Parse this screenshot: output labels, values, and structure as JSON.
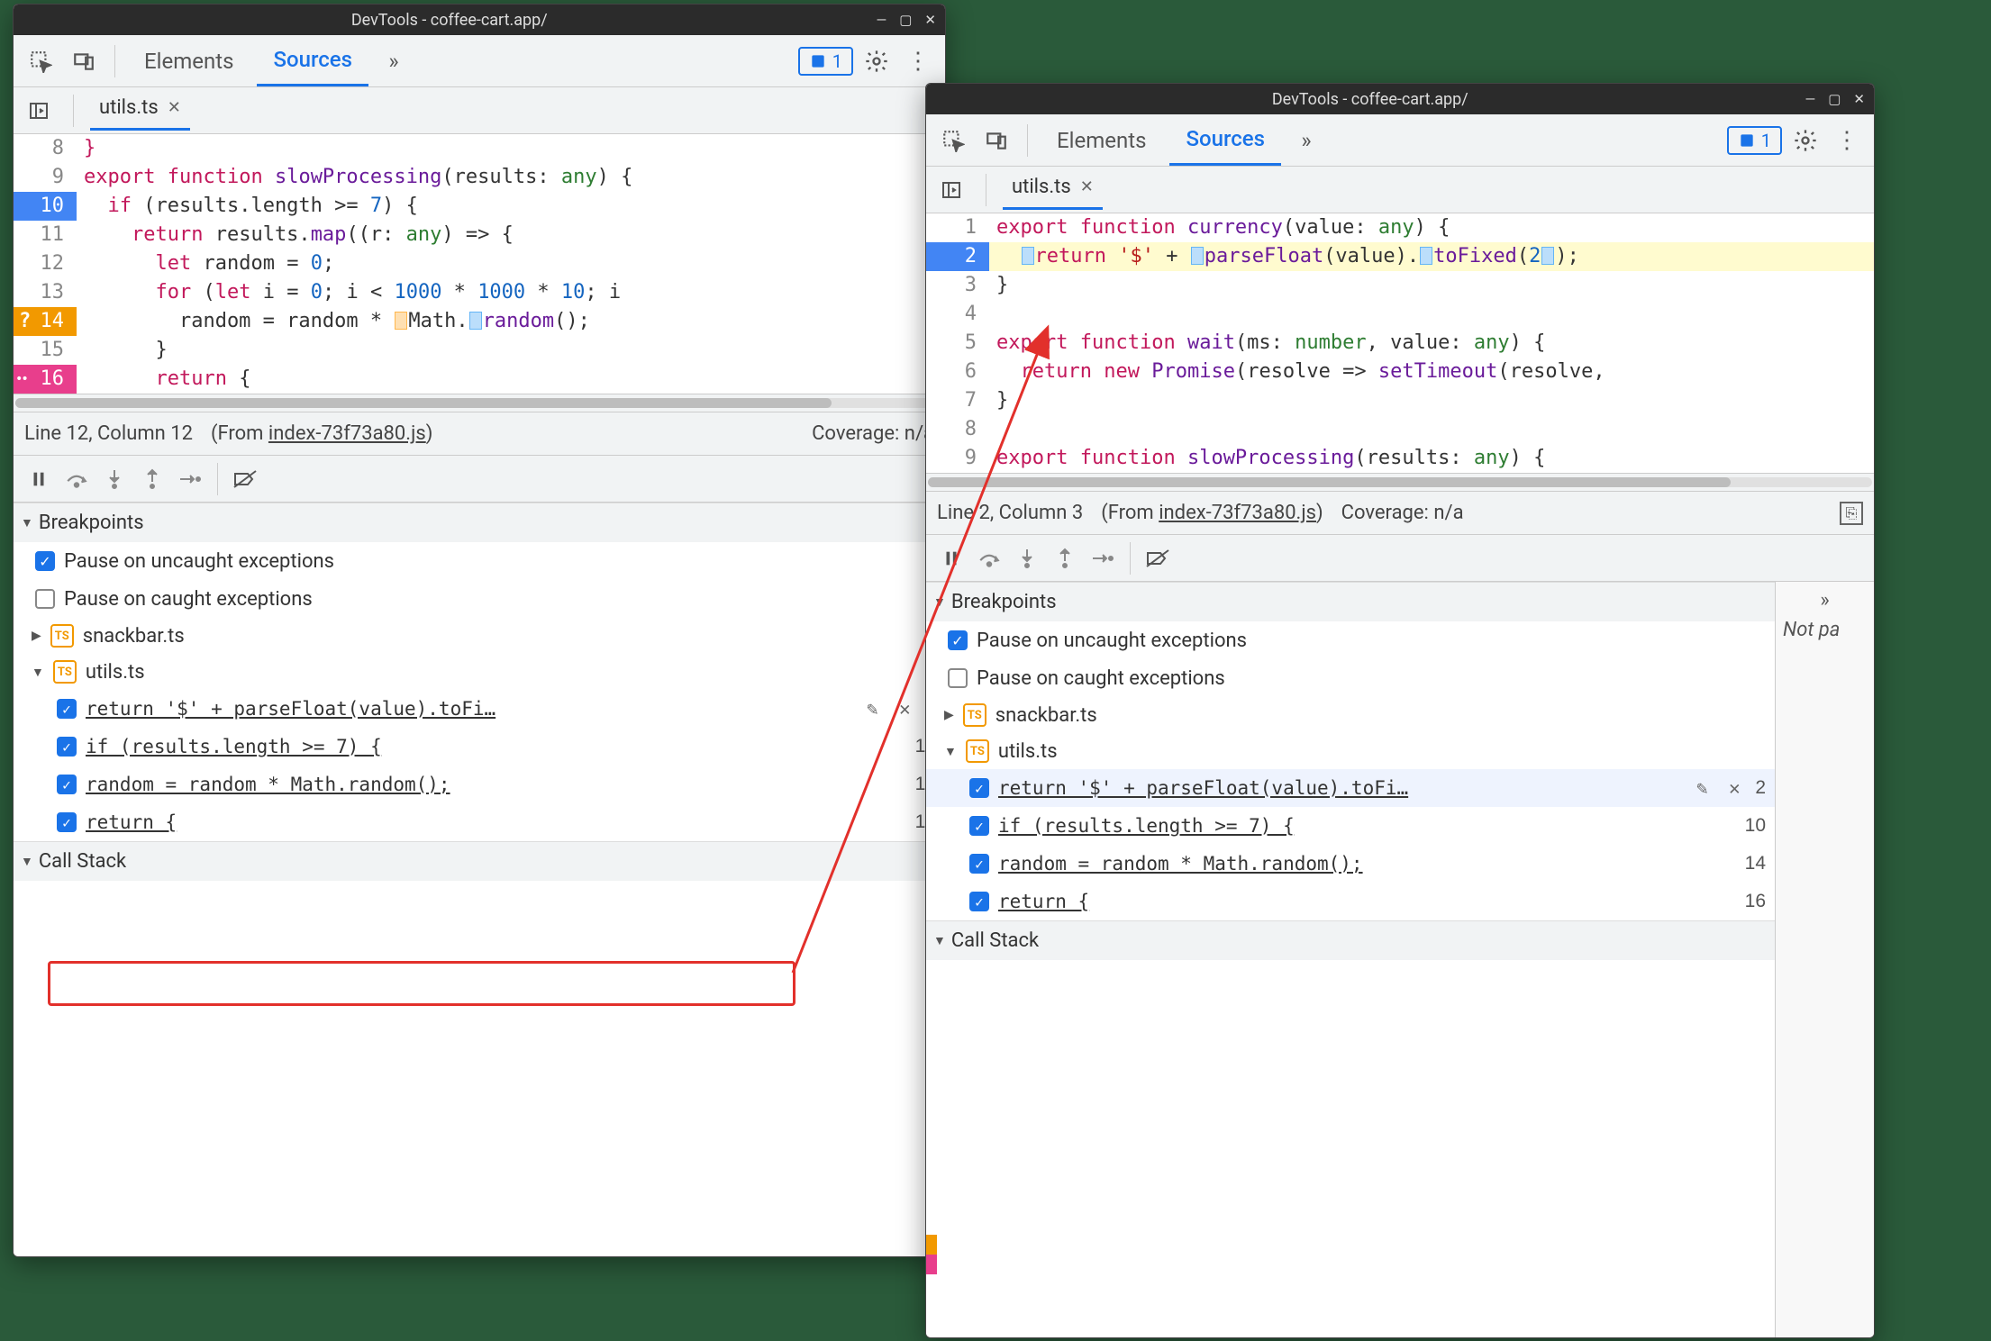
{
  "window_title": "DevTools - coffee-cart.app/",
  "toolbar_tabs": {
    "elements": "Elements",
    "sources": "Sources"
  },
  "issue_count": "1",
  "file_tab": "utils.ts",
  "left": {
    "status": {
      "line_col": "Line 12, Column 12",
      "from_prefix": "(From ",
      "from_link": "index-73f73a80.js",
      "from_suffix": ")",
      "coverage": "Coverage: n/a"
    },
    "code": [
      {
        "n": "8",
        "html": "<span class='kw'>}</span>"
      },
      {
        "n": "9",
        "html": "<span class='kw'>export</span> <span class='kw'>function</span> <span class='fn'>slowProcessing</span>(results: <span class='typ'>any</span>) {"
      },
      {
        "n": "10",
        "bp": "blue",
        "html": "  <span class='kw'>if</span> (results.length &gt;= <span class='num-lit'>7</span>) {"
      },
      {
        "n": "11",
        "html": "    <span class='kw'>return</span> results.<span class='fn'>map</span>((r: <span class='typ'>any</span>) =&gt; {"
      },
      {
        "n": "12",
        "html": "      <span class='kw'>let</span> random = <span class='num-lit'>0</span>;"
      },
      {
        "n": "13",
        "html": "      <span class='kw'>for</span> (<span class='kw'>let</span> i = <span class='num-lit'>0</span>; i &lt; <span class='num-lit'>1000</span> * <span class='num-lit'>1000</span> * <span class='num-lit'>10</span>; i"
      },
      {
        "n": "14",
        "bp": "orange",
        "bpq": true,
        "html": "        random = random * <span class='blk-marker blk-orange'></span>Math.<span class='blk-marker blk-blue'></span><span class='fn'>random</span>();"
      },
      {
        "n": "15",
        "html": "      }"
      },
      {
        "n": "16",
        "bp": "magenta",
        "bpd": true,
        "html": "      <span class='kw'>return</span> {"
      }
    ]
  },
  "right": {
    "status": {
      "line_col": "Line 2, Column 3",
      "from_prefix": "(From ",
      "from_link": "index-73f73a80.js",
      "from_suffix": ")",
      "coverage": "Coverage: n/a"
    },
    "notpaused": "Not pa",
    "code": [
      {
        "n": "1",
        "html": "<span class='kw'>export</span> <span class='kw'>function</span> <span class='fn'>currency</span>(value: <span class='typ'>any</span>) {"
      },
      {
        "n": "2",
        "bp": "blue",
        "hl": true,
        "html": "  <span class='blk-marker blk-blue'></span><span class='kw'>return</span> <span class='str'>'$'</span> + <span class='blk-marker blk-blue'></span><span class='fn'>parseFloat</span>(value).<span class='blk-marker blk-blue'></span><span class='fn'>toFixed</span>(<span class='num-lit'>2</span><span class='blk-marker blk-blue'></span>);"
      },
      {
        "n": "3",
        "html": "}"
      },
      {
        "n": "4",
        "html": ""
      },
      {
        "n": "5",
        "html": "<span class='kw'>export</span> <span class='kw'>function</span> <span class='fn'>wait</span>(ms: <span class='typ'>number</span>, value: <span class='typ'>any</span>) {"
      },
      {
        "n": "6",
        "html": "  <span class='kw'>return</span> <span class='kw'>new</span> <span class='fn'>Promise</span>(resolve =&gt; <span class='fn'>setTimeout</span>(resolve,"
      },
      {
        "n": "7",
        "html": "}"
      },
      {
        "n": "8",
        "html": ""
      },
      {
        "n": "9",
        "html": "<span class='kw'>export</span> <span class='kw'>function</span> <span class='fn'>slowProcessing</span>(results: <span class='typ'>any</span>) {"
      }
    ]
  },
  "sections": {
    "breakpoints": "Breakpoints",
    "callstack": "Call Stack",
    "pause_uncaught": "Pause on uncaught exceptions",
    "pause_caught": "Pause on caught exceptions",
    "files": {
      "snackbar": "snackbar.ts",
      "utils": "utils.ts"
    },
    "items": [
      {
        "label": "return '$' + parseFloat(value).toFi…",
        "line": "2",
        "selected": true,
        "edit": true
      },
      {
        "label": "if (results.length >= 7) {",
        "line": "10"
      },
      {
        "label": "random = random * Math.random();",
        "line": "14"
      },
      {
        "label": "return {",
        "line": "16"
      }
    ]
  }
}
